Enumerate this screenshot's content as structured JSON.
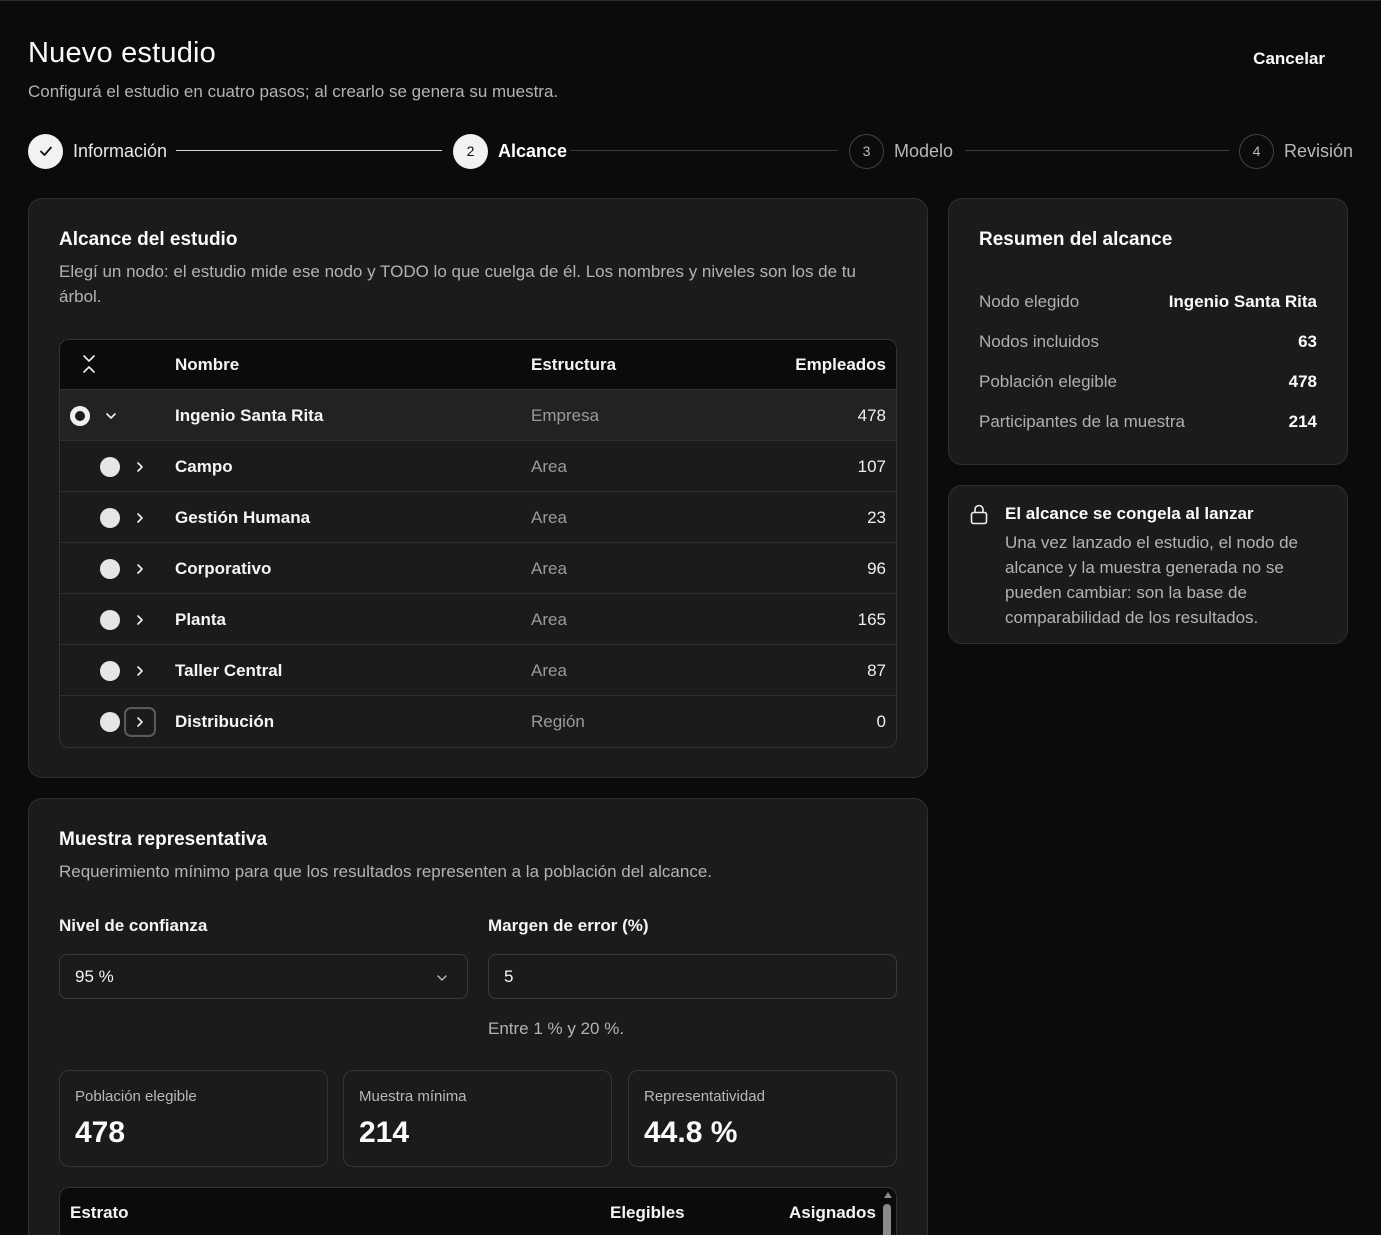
{
  "header": {
    "title": "Nuevo estudio",
    "subtitle": "Configurá el estudio en cuatro pasos; al crearlo se genera su muestra.",
    "cancel_label": "Cancelar"
  },
  "stepper": {
    "steps": [
      {
        "label": "Información",
        "number": "1",
        "state": "done"
      },
      {
        "label": "Alcance",
        "number": "2",
        "state": "active"
      },
      {
        "label": "Modelo",
        "number": "3",
        "state": "pending"
      },
      {
        "label": "Revisión",
        "number": "4",
        "state": "pending"
      }
    ]
  },
  "scope": {
    "title": "Alcance del estudio",
    "description": "Elegí un nodo: el estudio mide ese nodo y TODO lo que cuelga de él. Los nombres y niveles son los de tu árbol.",
    "table": {
      "headers": {
        "name": "Nombre",
        "structure": "Estructura",
        "employees": "Empleados"
      },
      "rows": [
        {
          "name": "Ingenio Santa Rita",
          "structure": "Empresa",
          "employees": "478"
        },
        {
          "name": "Campo",
          "structure": "Area",
          "employees": "107"
        },
        {
          "name": "Gestión Humana",
          "structure": "Area",
          "employees": "23"
        },
        {
          "name": "Corporativo",
          "structure": "Area",
          "employees": "96"
        },
        {
          "name": "Planta",
          "structure": "Area",
          "employees": "165"
        },
        {
          "name": "Taller Central",
          "structure": "Area",
          "employees": "87"
        },
        {
          "name": "Distribución",
          "structure": "Región",
          "employees": "0"
        }
      ]
    }
  },
  "summary": {
    "title": "Resumen del alcance",
    "rows": [
      {
        "label": "Nodo elegido",
        "value": "Ingenio Santa Rita"
      },
      {
        "label": "Nodos incluidos",
        "value": "63"
      },
      {
        "label": "Población elegible",
        "value": "478"
      },
      {
        "label": "Participantes de la muestra",
        "value": "214"
      }
    ]
  },
  "notice": {
    "title": "El alcance se congela al lanzar",
    "text": "Una vez lanzado el estudio, el nodo de alcance y la muestra generada no se pueden cambiar: son la base de comparabilidad de los resultados."
  },
  "sample": {
    "title": "Muestra representativa",
    "description": "Requerimiento mínimo para que los resultados representen a la población del alcance.",
    "confidence_label": "Nivel de confianza",
    "confidence_value": "95 %",
    "margin_label": "Margen de error (%)",
    "margin_value": "5",
    "margin_hint": "Entre 1 % y 20 %.",
    "stats": [
      {
        "label": "Población elegible",
        "value": "478"
      },
      {
        "label": "Muestra mínima",
        "value": "214"
      },
      {
        "label": "Representatividad",
        "value": "44.8 %"
      }
    ],
    "strata_headers": {
      "stratum": "Estrato",
      "eligible": "Elegibles",
      "assigned": "Asignados"
    }
  }
}
